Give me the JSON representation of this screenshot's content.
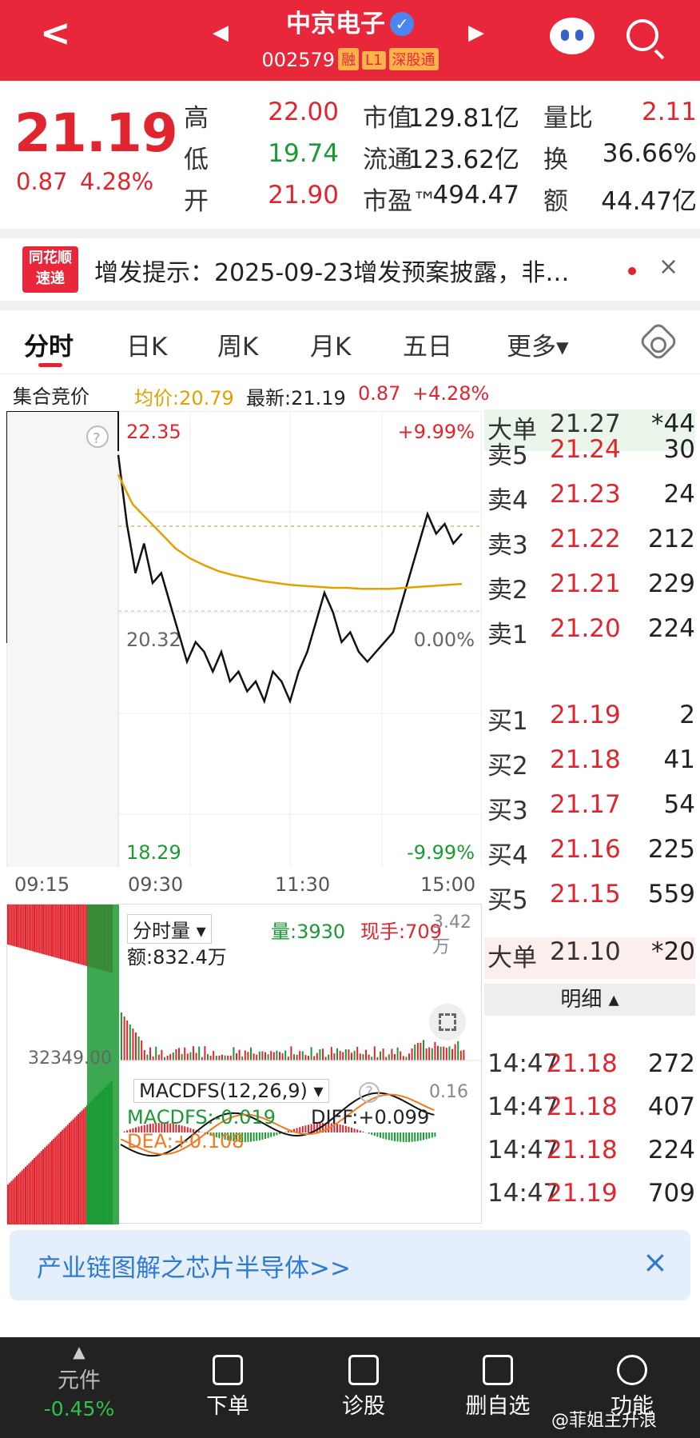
{
  "header": {
    "name": "中京电子",
    "verified": "✓",
    "code": "002579",
    "tags": [
      "融",
      "L1",
      "深股通"
    ]
  },
  "quote": {
    "price": "21.19",
    "change": "0.87",
    "change_pct": "4.28%",
    "rows": [
      {
        "k1": "高",
        "v1": "22.00",
        "k2": "市值",
        "v2": "129.81亿",
        "k3": "量比",
        "v3": "2.11"
      },
      {
        "k1": "低",
        "v1": "19.74",
        "k2": "流通",
        "v2": "123.62亿",
        "k3": "换",
        "v3": "36.66%"
      },
      {
        "k1": "开",
        "v1": "21.90",
        "k2": "市盈™",
        "v2": "494.47",
        "k3": "额",
        "v3": "44.47亿"
      }
    ]
  },
  "news": {
    "logo1": "同花顺",
    "logo2": "速递",
    "text": "增发提示：2025-09-23增发预案披露，非…",
    "close": "×"
  },
  "tabs": [
    "分时",
    "日K",
    "周K",
    "月K",
    "五日",
    "更多▾"
  ],
  "info": {
    "auction": "集合竞价",
    "avg": "均价:20.79",
    "latest": "最新:21.19",
    "chg": "0.87",
    "pct": "+4.28%"
  },
  "chart_data": [
    {
      "type": "line",
      "ylim": [
        18.29,
        22.35
      ],
      "yticks": [
        "22.35",
        "20.32",
        "18.29"
      ],
      "right_ticks": [
        "+9.99%",
        "0.00%",
        "-9.99%"
      ],
      "x_ticks": [
        "09:15",
        "09:30",
        "11:30",
        "15:00"
      ],
      "series": [
        {
          "values": [
            22.1,
            21.4,
            20.9,
            21.2,
            20.8,
            20.9,
            20.6,
            20.3,
            20.0,
            20.2,
            20.1,
            19.9,
            20.1,
            19.8,
            19.9,
            19.7,
            19.8,
            19.6,
            19.9,
            19.8,
            19.6,
            19.9,
            20.1,
            20.4,
            20.7,
            20.5,
            20.2,
            20.3,
            20.1,
            20.0,
            20.1,
            20.2,
            20.3,
            20.6,
            20.9,
            21.2,
            21.5,
            21.3,
            21.4,
            21.2,
            21.3
          ],
          "color": "#111111"
        },
        {
          "values": [
            21.9,
            21.6,
            21.45,
            21.3,
            21.15,
            21.05,
            20.98,
            20.92,
            20.88,
            20.85,
            20.82,
            20.8,
            20.78,
            20.77,
            20.76,
            20.75,
            20.75,
            20.74,
            20.74,
            20.74,
            20.75,
            20.76,
            20.77,
            20.78,
            20.79
          ],
          "color": "#e1a100"
        }
      ]
    },
    {
      "type": "bar",
      "label": "分时量",
      "vol": "量:3930",
      "hand": "现手:709",
      "maxv": "3.42万",
      "amt": "额:832.4万",
      "left_val": "32349.00"
    },
    {
      "type": "line",
      "label": "MACDFS(12,26,9)",
      "macd": "MACDFS:-0.019",
      "diff": "DIFF:+0.099",
      "dea": "DEA:+0.108",
      "top": "0.16"
    }
  ],
  "book": {
    "bigbuy": {
      "l": "大单",
      "p": "21.27",
      "v": "*44"
    },
    "asks": [
      {
        "l": "卖5",
        "p": "21.24",
        "v": "30"
      },
      {
        "l": "卖4",
        "p": "21.23",
        "v": "24"
      },
      {
        "l": "卖3",
        "p": "21.22",
        "v": "212"
      },
      {
        "l": "卖2",
        "p": "21.21",
        "v": "229"
      },
      {
        "l": "卖1",
        "p": "21.20",
        "v": "224"
      }
    ],
    "bids": [
      {
        "l": "买1",
        "p": "21.19",
        "v": "2"
      },
      {
        "l": "买2",
        "p": "21.18",
        "v": "41"
      },
      {
        "l": "买3",
        "p": "21.17",
        "v": "54"
      },
      {
        "l": "买4",
        "p": "21.16",
        "v": "225"
      },
      {
        "l": "买5",
        "p": "21.15",
        "v": "559"
      }
    ],
    "bigsell": {
      "l": "大单",
      "p": "21.10",
      "v": "*20"
    },
    "detail": "明细 ▴",
    "ticks": [
      {
        "t": "14:47",
        "p": "21.18",
        "v": "272"
      },
      {
        "t": "14:47",
        "p": "21.18",
        "v": "407"
      },
      {
        "t": "14:47",
        "p": "21.18",
        "v": "224"
      },
      {
        "t": "14:47",
        "p": "21.19",
        "v": "709"
      }
    ]
  },
  "banner": {
    "text": "产业链图解之芯片半导体>>",
    "close": "×"
  },
  "bottom": {
    "items": [
      "元件",
      "下单",
      "诊股",
      "删自选",
      "功能"
    ],
    "pct": "-0.45%",
    "watermark": "@菲姐主升浪"
  },
  "colors": {
    "red": "#e0252f",
    "green": "#1a9a34",
    "gold": "#e1a100",
    "header": "#e8283a"
  }
}
